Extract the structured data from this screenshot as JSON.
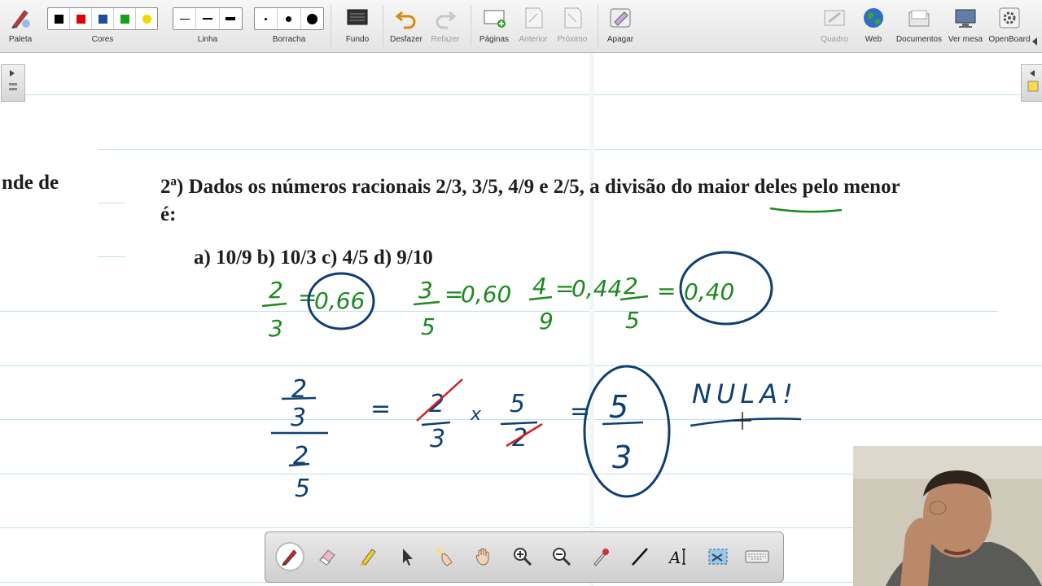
{
  "toolbar": {
    "left": [
      {
        "id": "paleta",
        "label": "Paleta",
        "icon": "palette-pen-icon"
      },
      {
        "id": "cores",
        "label": "Cores",
        "icon": "color-swatches",
        "colors": [
          "#000000",
          "#e00000",
          "#1f4e9c",
          "#19a019",
          "#f0d800"
        ]
      },
      {
        "id": "linha",
        "label": "Linha",
        "icon": "line-width-options"
      },
      {
        "id": "borracha",
        "label": "Borracha",
        "icon": "eraser-size-options"
      },
      {
        "id": "fundo",
        "label": "Fundo",
        "icon": "background-grid-icon"
      },
      {
        "id": "desfazer",
        "label": "Desfazer",
        "icon": "undo-icon"
      },
      {
        "id": "refazer",
        "label": "Refazer",
        "icon": "redo-icon",
        "disabled": true
      },
      {
        "id": "paginas",
        "label": "Páginas",
        "icon": "add-page-icon"
      },
      {
        "id": "anterior",
        "label": "Anterior",
        "icon": "previous-page-icon",
        "disabled": true
      },
      {
        "id": "proximo",
        "label": "Próximo",
        "icon": "next-page-icon",
        "disabled": true
      },
      {
        "id": "apagar",
        "label": "Apagar",
        "icon": "clear-page-icon"
      }
    ],
    "right": [
      {
        "id": "quadro",
        "label": "Quadro",
        "icon": "board-icon",
        "disabled": true
      },
      {
        "id": "web",
        "label": "Web",
        "icon": "globe-icon"
      },
      {
        "id": "documentos",
        "label": "Documentos",
        "icon": "folder-icon"
      },
      {
        "id": "vermesa",
        "label": "Ver mesa",
        "icon": "desktop-icon"
      },
      {
        "id": "openboard",
        "label": "OpenBoard",
        "icon": "gear-icon"
      }
    ]
  },
  "problem": {
    "prev_fragment": "nde  de",
    "question_line1": "2ª) Dados os números racionais 2/3, 3/5, 4/9 e 2/5, a divisão do maior deles pelo menor",
    "question_line2": "é:",
    "options": "a)   10/9  b) 10/3  c) 4/5  d) 9/10"
  },
  "handwriting": {
    "row1": [
      {
        "num": "2",
        "den": "3",
        "eq": "=",
        "val": "0,66"
      },
      {
        "num": "3",
        "den": "5",
        "eq": "=",
        "val": "0,60"
      },
      {
        "num": "4",
        "den": "9",
        "eq": "=",
        "val": "0,44"
      },
      {
        "num": "2",
        "den": "5",
        "eq": "=",
        "val": "0,40"
      }
    ],
    "cf_top_num": "2",
    "cf_top_den": "3",
    "cf_bot_num": "2",
    "cf_bot_den": "5",
    "eq1": "=",
    "r_num1": "2",
    "r_den1": "3",
    "times": "x",
    "r_num2": "5",
    "r_den2": "2",
    "eq2": "=",
    "res_num": "5",
    "res_den": "3",
    "nula": "NULA!"
  },
  "colors": {
    "green_ink": "#1c8a1c",
    "blue_ink": "#0e3f73",
    "red_ink": "#d42020",
    "rule": "#bfe0ea"
  },
  "dock": [
    "pen-icon",
    "eraser-icon",
    "highlighter-icon",
    "pointer-arrow-icon",
    "laser-pointer-icon",
    "hand-icon",
    "zoom-in-icon",
    "zoom-out-icon",
    "color-picker-icon",
    "line-tool-icon",
    "text-tool-icon",
    "capture-icon",
    "keyboard-icon"
  ]
}
